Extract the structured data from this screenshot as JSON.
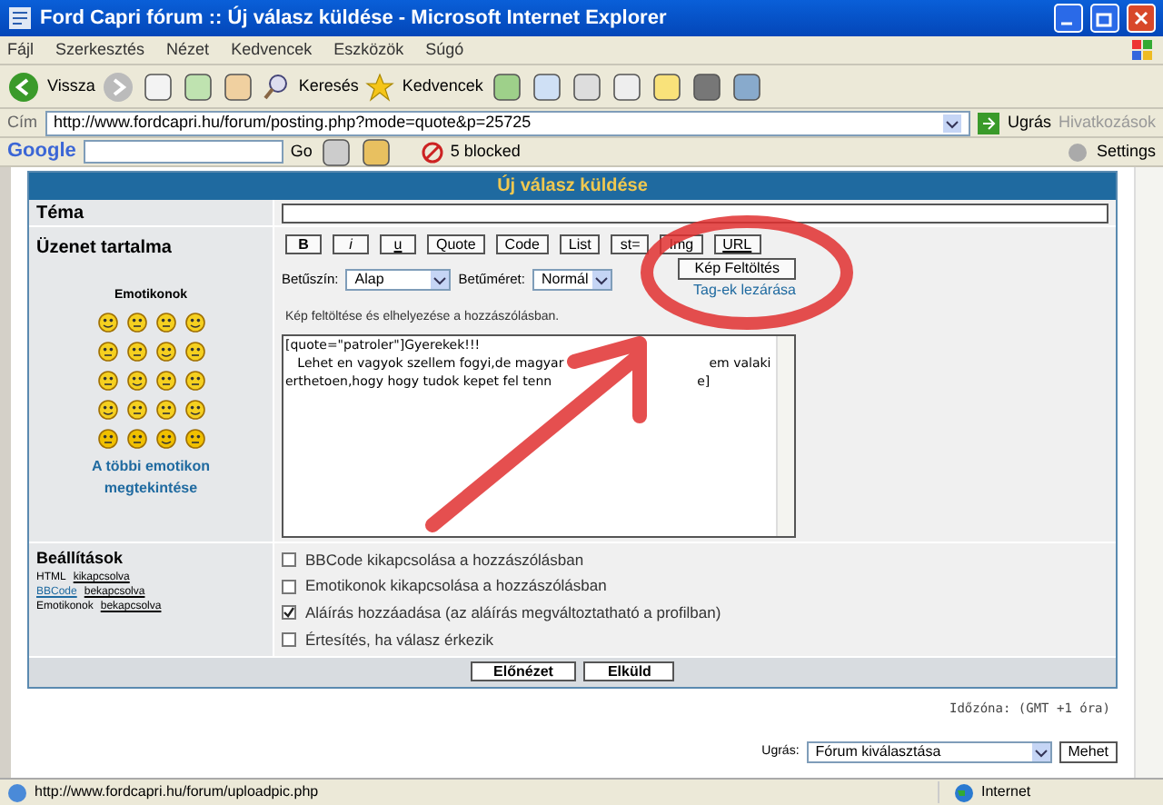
{
  "window": {
    "title": "Ford Capri fórum :: Új válasz küldése - Microsoft Internet Explorer"
  },
  "menu": [
    "Fájl",
    "Szerkesztés",
    "Nézet",
    "Kedvencek",
    "Eszközök",
    "Súgó"
  ],
  "toolbar": {
    "back": "Vissza",
    "search": "Keresés",
    "favorites": "Kedvencek"
  },
  "address": {
    "label": "Cím",
    "url": "http://www.fordcapri.hu/forum/posting.php?mode=quote&p=25725",
    "go": "Ugrás",
    "links": "Hivatkozások"
  },
  "google_bar": {
    "logo": "Google",
    "go": "Go",
    "blocked": "5 blocked",
    "settings": "Settings"
  },
  "form": {
    "title": "Új válasz küldése",
    "subject_label": "Téma",
    "message_label": "Üzenet tartalma",
    "emoticons_title": "Emotikonok",
    "more_emoticons": "A többi emotikon megtekintése",
    "format_buttons": [
      {
        "label": "B",
        "kind": "bold"
      },
      {
        "label": "i",
        "kind": "italic"
      },
      {
        "label": "u",
        "kind": "underline"
      },
      {
        "label": "Quote",
        "kind": "plain"
      },
      {
        "label": "Code",
        "kind": "plain"
      },
      {
        "label": "List",
        "kind": "plain"
      },
      {
        "label": "st=",
        "kind": "plain"
      },
      {
        "label": "Img",
        "kind": "plain"
      },
      {
        "label": "URL",
        "kind": "underline"
      }
    ],
    "upload_button": "Kép Feltöltés",
    "close_tags": "Tag-ek lezárása",
    "font_color_label": "Betűszín:",
    "font_color": "Alap",
    "font_size_label": "Betűméret:",
    "font_size": "Normál",
    "hint": "Kép feltöltése és elhelyezése a hozzászólásban.",
    "message_lines": [
      [
        "[quote=\"patroler\"]Gyerekek!!!"
      ],
      [
        "   Lehet en vagyok szellem fogyi,de magyar",
        "em valaki"
      ],
      [
        "erthetoen,hogy hogy tudok kepet fel tenn",
        "e]"
      ]
    ]
  },
  "options": {
    "label": "Beállítások",
    "status": [
      {
        "name": "HTML",
        "value": "kikapcsolva",
        "link": false
      },
      {
        "name": "BBCode",
        "value": "bekapcsolva",
        "link": true
      },
      {
        "name": "Emotikonok",
        "value": "bekapcsolva",
        "link": false
      }
    ],
    "checkboxes": [
      {
        "label": "BBCode kikapcsolása a hozzászólásban",
        "checked": false
      },
      {
        "label": "Emotikonok kikapcsolása a hozzászólásban",
        "checked": false
      },
      {
        "label": "Aláírás hozzáadása (az aláírás megváltoztatható a profilban)",
        "checked": true
      },
      {
        "label": "Értesítés, ha válasz érkezik",
        "checked": false
      }
    ]
  },
  "buttons": [
    "Előnézet",
    "Elküld"
  ],
  "timezone": "Időzóna: (GMT +1 óra)",
  "jump": {
    "label": "Ugrás:",
    "value": "Fórum kiválasztása",
    "button": "Mehet"
  },
  "status_bar": {
    "url": "http://www.fordcapri.hu/forum/uploadpic.php",
    "zone": "Internet"
  }
}
